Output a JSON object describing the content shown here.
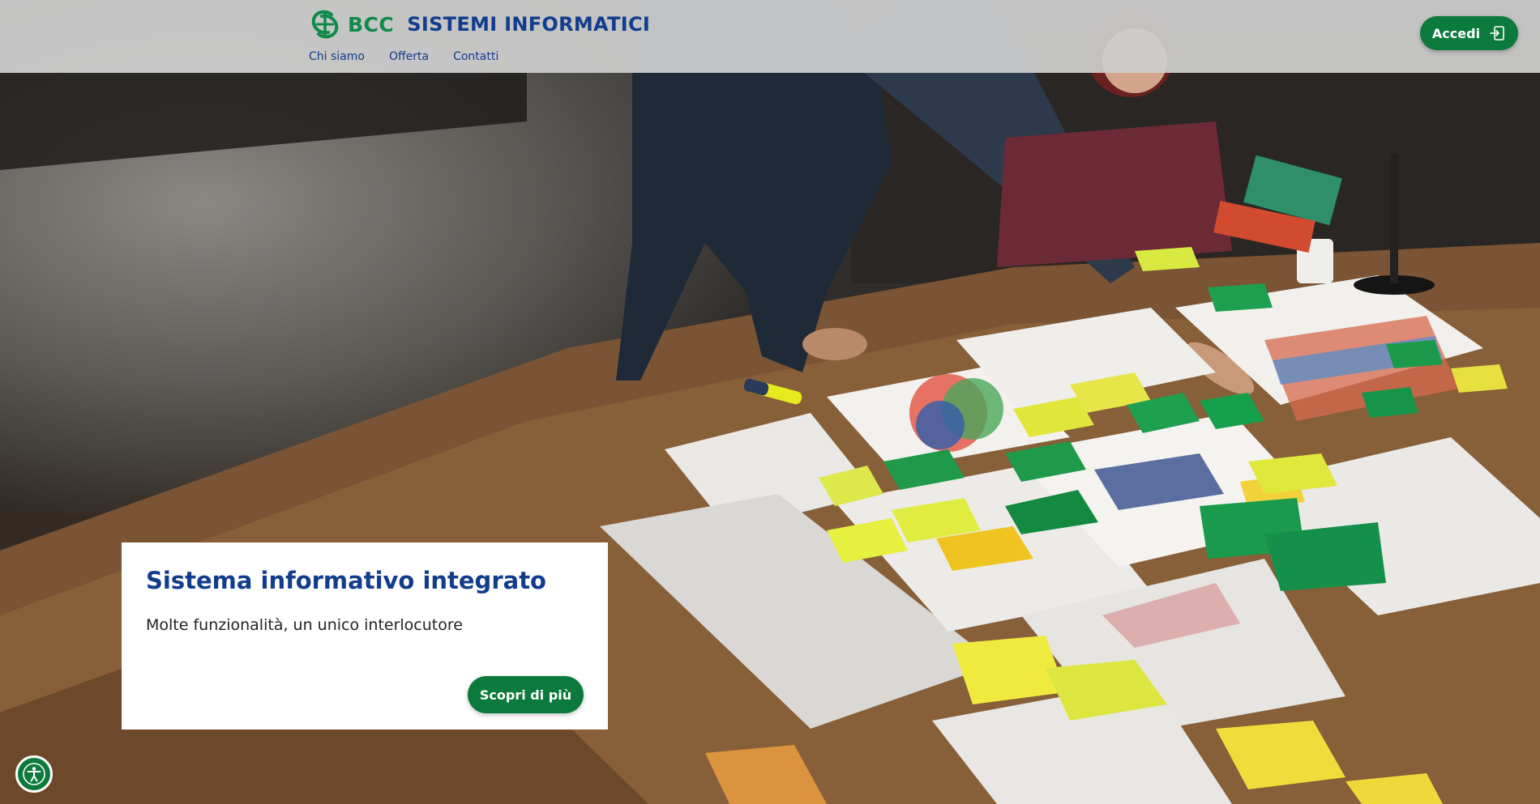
{
  "brand": {
    "short": "BCC",
    "name": "SISTEMI INFORMATICI",
    "green": "#0f8a4a",
    "blue": "#123c8c"
  },
  "nav": {
    "items": [
      {
        "label": "Chi siamo"
      },
      {
        "label": "Offerta"
      },
      {
        "label": "Contatti"
      }
    ]
  },
  "header": {
    "login_label": "Accedi",
    "login_icon": "login-door-icon"
  },
  "hero": {
    "title": "Sistema informativo integrato",
    "subtitle": "Molte funzionalità, un unico interlocutore",
    "cta_label": "Scopri di più",
    "background": "office-team-table-sticky-notes-photo"
  },
  "accessibility": {
    "icon": "accessibility-person-icon"
  },
  "colors": {
    "button_green": "#0b7a3c",
    "header_bg": "#cdcdcd"
  }
}
